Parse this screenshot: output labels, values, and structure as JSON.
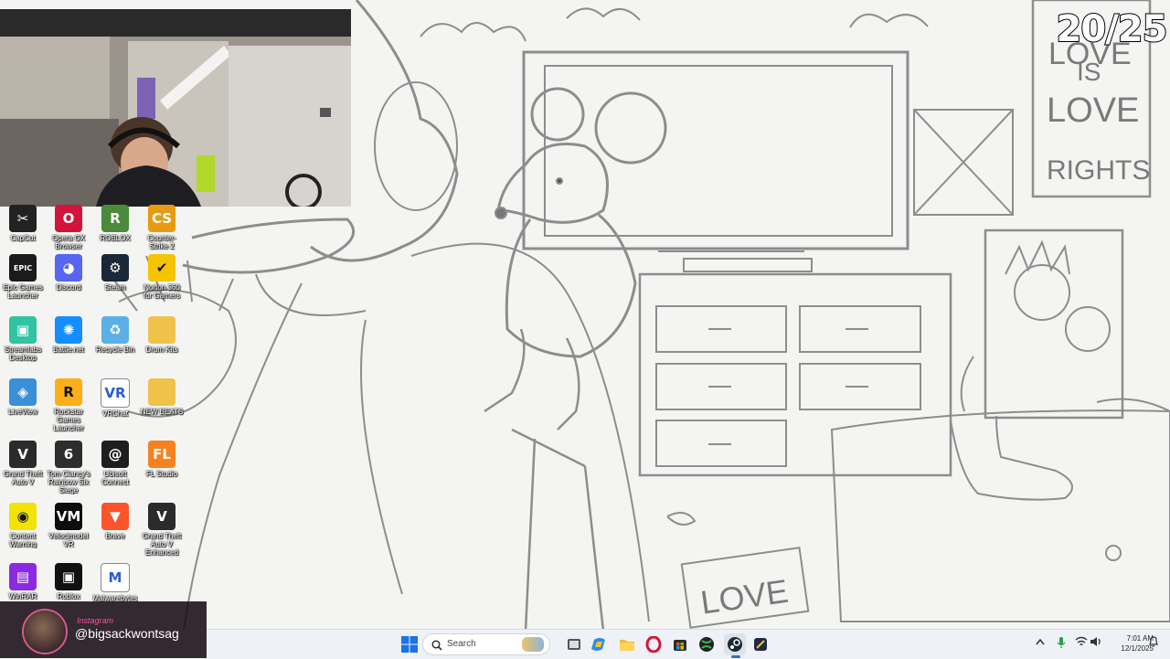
{
  "stream_overlay": {
    "counter": "20/25",
    "instagram": {
      "platform": "Instagram",
      "handle": "@bigsackwontsag"
    }
  },
  "wallpaper": {
    "description_icons": "pencil sketch",
    "poster_text_top": [
      "LOVE",
      "IS",
      "LOVE"
    ],
    "poster_text_bottom": "RIGHTS",
    "sign_text": "LOVE"
  },
  "desktop_icons": [
    {
      "label": "CapCut",
      "icon": "capcut-icon",
      "color": "#222222",
      "glyph": "✂"
    },
    {
      "label": "Opera GX Browser",
      "icon": "opera-gx-icon",
      "color": "#d3143a",
      "glyph": "O"
    },
    {
      "label": "ROBLOX",
      "icon": "roblox-icon",
      "color": "#4a8a3a",
      "glyph": "R"
    },
    {
      "label": "Counter-Strike 2",
      "icon": "counter-strike-icon",
      "color": "#e89a12",
      "glyph": "CS"
    },
    {
      "label": "Epic Games Launcher",
      "icon": "epic-games-icon",
      "color": "#1b1b1b",
      "glyph": "EPIC"
    },
    {
      "label": "Discord",
      "icon": "discord-icon",
      "color": "#5865f2",
      "glyph": "◕"
    },
    {
      "label": "Steam",
      "icon": "steam-icon",
      "color": "#1b2838",
      "glyph": "⚙"
    },
    {
      "label": "Norton 360 for Gamers",
      "icon": "norton-icon",
      "color": "#f5c400",
      "glyph": "✔"
    },
    {
      "label": "Streamlabs Desktop",
      "icon": "streamlabs-icon",
      "color": "#31c3a2",
      "glyph": "▣"
    },
    {
      "label": "Battle.net",
      "icon": "battlenet-icon",
      "color": "#148eff",
      "glyph": "✺"
    },
    {
      "label": "Recycle Bin",
      "icon": "recycle-bin-icon",
      "color": "#5ab0e6",
      "glyph": "♻"
    },
    {
      "label": "Drum Kits",
      "icon": "folder-icon",
      "color": "#f0c24a",
      "glyph": ""
    },
    {
      "label": "LiveView",
      "icon": "liveview-icon",
      "color": "#3a8fd8",
      "glyph": "◈"
    },
    {
      "label": "Rockstar Games Launcher",
      "icon": "rockstar-icon",
      "color": "#fcaf17",
      "glyph": "R"
    },
    {
      "label": "VRChat",
      "icon": "vrchat-icon",
      "color": "#ffffff",
      "glyph": "VR"
    },
    {
      "label": "NEW BEATS",
      "icon": "folder-icon",
      "color": "#f0c24a",
      "glyph": ""
    },
    {
      "label": "Grand Theft Auto V",
      "icon": "gta-v-icon",
      "color": "#2b2b2b",
      "glyph": "V"
    },
    {
      "label": "Tom Clancy's Rainbow Six Siege",
      "icon": "rainbow-six-icon",
      "color": "#2d2d2d",
      "glyph": "6"
    },
    {
      "label": "Ubisoft Connect",
      "icon": "ubisoft-icon",
      "color": "#1e1e1e",
      "glyph": "@"
    },
    {
      "label": "FL Studio",
      "icon": "fl-studio-icon",
      "color": "#f58220",
      "glyph": "FL"
    },
    {
      "label": "Content Warning",
      "icon": "content-warning-icon",
      "color": "#f2e205",
      "glyph": "◉"
    },
    {
      "label": "Velocimodel VR",
      "icon": "velocimodel-icon",
      "color": "#0d0d0d",
      "glyph": "VM"
    },
    {
      "label": "Brave",
      "icon": "brave-icon",
      "color": "#fb542b",
      "glyph": "▼"
    },
    {
      "label": "Grand Theft Auto V Enhanced",
      "icon": "gta-v-icon",
      "color": "#2b2b2b",
      "glyph": "V"
    },
    {
      "label": "WinRAR",
      "icon": "winrar-icon",
      "color": "#8a2be2",
      "glyph": "▤"
    },
    {
      "label": "Roblox",
      "icon": "roblox-icon",
      "color": "#111111",
      "glyph": "▣"
    },
    {
      "label": "Malwarebytes",
      "icon": "malwarebytes-icon",
      "color": "#ffffff",
      "glyph": "M"
    }
  ],
  "taskbar": {
    "search_label": "Search",
    "pinned": [
      {
        "name": "start-button",
        "icon": "windows-icon"
      },
      {
        "name": "task-view",
        "icon": "task-view-icon"
      },
      {
        "name": "copilot",
        "icon": "copilot-icon"
      },
      {
        "name": "file-explorer",
        "icon": "folder-icon"
      },
      {
        "name": "opera-gx",
        "icon": "opera-gx-icon"
      },
      {
        "name": "microsoft-store",
        "icon": "store-icon"
      },
      {
        "name": "xbox",
        "icon": "xbox-icon"
      },
      {
        "name": "steam",
        "icon": "steam-icon"
      },
      {
        "name": "snipping-tool",
        "icon": "snip-icon"
      }
    ],
    "clock": {
      "time": "7:01 AM",
      "date": "12/1/2025"
    }
  }
}
